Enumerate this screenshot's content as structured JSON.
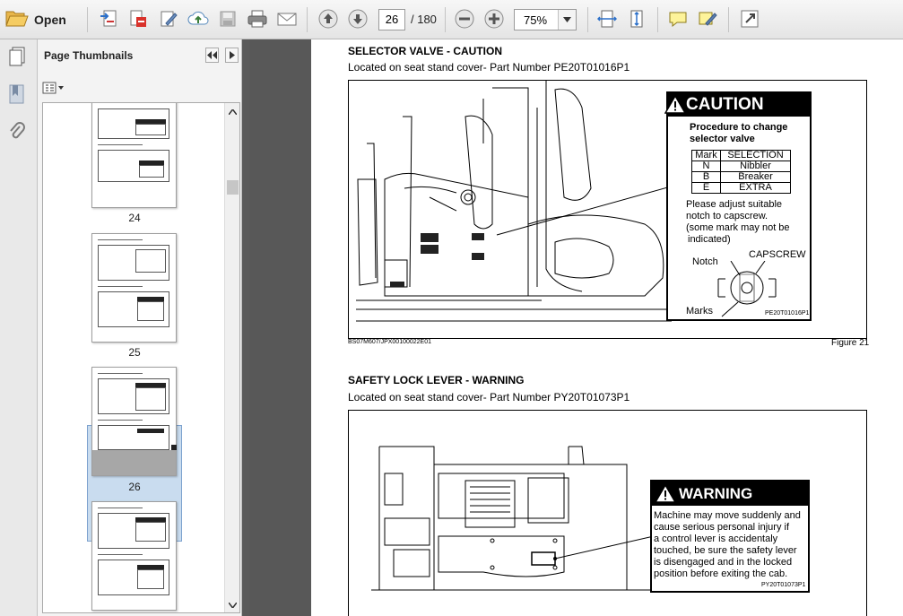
{
  "toolbar": {
    "open_label": "Open",
    "page_number": "26",
    "page_total": "/ 180",
    "zoom": "75%"
  },
  "panel": {
    "title": "Page Thumbnails",
    "thumbnails": [
      {
        "page": "24"
      },
      {
        "page": "25"
      },
      {
        "page": "26",
        "selected": true
      }
    ]
  },
  "document": {
    "section1": {
      "heading": "SELECTOR VALVE - CAUTION",
      "location": "Located on seat stand cover- Part Number PE20T01016P1",
      "label": {
        "header": "CAUTION",
        "title_line1": "Procedure to change",
        "title_line2": "selector valve",
        "table_headers": [
          "Mark",
          "SELECTION"
        ],
        "table_rows": [
          [
            "N",
            "Nibbler"
          ],
          [
            "B",
            "Breaker"
          ],
          [
            "E",
            "EXTRA"
          ]
        ],
        "note_line1": "Please adjust suitable",
        "note_line2": "notch to capscrew.",
        "note_line3": "(some mark may not be",
        "note_line4": "indicated)",
        "notch": "Notch",
        "capscrew": "CAPSCREW",
        "marks": "Marks",
        "part_code": "PE20T01016P1"
      },
      "image_code": "BS07M607/JPX00100022E01",
      "figure": "Figure 21"
    },
    "section2": {
      "heading": "SAFETY LOCK LEVER - WARNING",
      "location": "Located on seat stand cover- Part Number PY20T01073P1",
      "label": {
        "header": "WARNING",
        "line1": "Machine may move suddenly and",
        "line2": "cause serious personal injury if",
        "line3": "a control lever is accidentaly",
        "line4": "touched, be sure the safety lever",
        "line5": "is disengaged and in the locked",
        "line6": "position before exiting the cab.",
        "part_code": "PY20T01073P1"
      }
    }
  },
  "icons": [
    "open-folder-icon",
    "create-pdf-icon",
    "convert-icon",
    "edit-icon",
    "upload-icon",
    "save-icon",
    "print-icon",
    "email-icon",
    "previous-page-icon",
    "next-page-icon",
    "zoom-out-icon",
    "zoom-in-icon",
    "fit-width-icon",
    "fit-page-icon",
    "comment-icon",
    "highlight-icon",
    "expand-icon",
    "page-thumbnails-icon",
    "attachments-icon",
    "options-icon"
  ]
}
